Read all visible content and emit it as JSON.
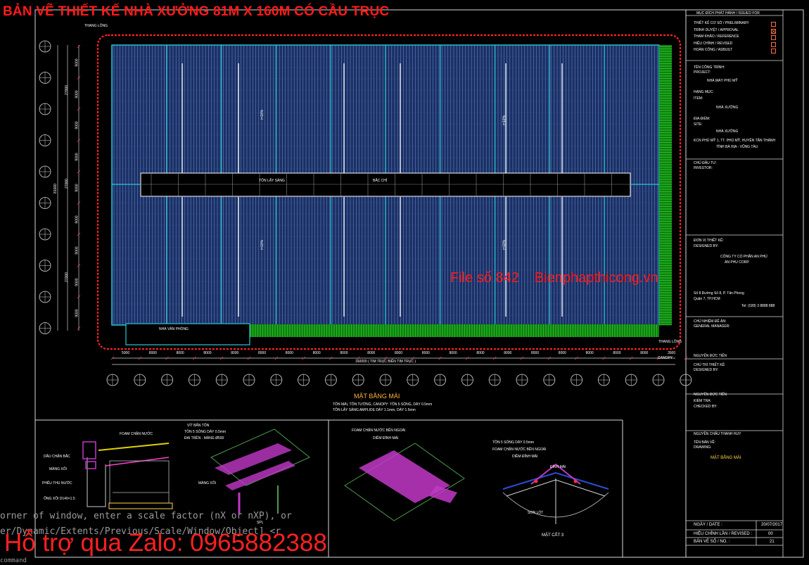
{
  "title": "BẢN VẼ THIẾT KẾ NHÀ XƯỞNG 81M X 160M CÓ CẦU TRỤC",
  "watermark": {
    "file": "File số 842",
    "site": "Bienphapthicong.vn"
  },
  "support": "Hỗ trợ qua Zalo: 0965882388",
  "command_lines": [
    "orner of window, enter a scale factor (nX or nXP), or",
    "er/Dynamic/Extents/Previous/Scale/Window/Object] <r",
    "command"
  ],
  "plan": {
    "labels": {
      "top_left": "THANG LÔNG",
      "skylight": "TÔN LẤY SÁNG",
      "ridge": "BẮC CHỈ",
      "office": "NHÀ VĂN PHÒNG",
      "canopy": "CANOPY",
      "bottom_right": "THANG LÔNG",
      "dim_total": "160000 ( TIM TRỤC BIÊN TIM TRỤC )",
      "slope_a": "i=10%",
      "slope_b": "i=10%",
      "slope_c": "i=10%",
      "slope_d": "i=10%",
      "left_total": "81000",
      "left_dims": [
        "9000",
        "9000",
        "9000",
        "9000",
        "9000",
        "9000",
        "9000",
        "9000",
        "9000"
      ],
      "left_sub": [
        "27000",
        "27000",
        "27000"
      ],
      "bottom_dims": [
        "5000",
        "8000",
        "8000",
        "8000",
        "8000",
        "8000",
        "8000",
        "8000",
        "8000",
        "8000",
        "8000",
        "8000",
        "8000",
        "8000",
        "8000",
        "8000",
        "8000",
        "8000",
        "8000",
        "8000",
        "3500"
      ]
    },
    "caption": "MẶT BẰNG MÁI",
    "notes": [
      "TÔN MÁI, TÔN TƯỜNG, CANOPY: TÔN 5 SÓNG, DÀY 0.5mm",
      "TÔN LẤY SÁNG AMPLIDE  DÀY 1.1mm, DÀY 1.5mm"
    ]
  },
  "details": {
    "left": [
      "FOAM CHẶN NƯỚC",
      "DẦU CHẶN BẮC",
      "MÁNG XỐI",
      "PHỄU THU NƯỚC",
      "ỐNG XỐI D140×1.5",
      "VÍT BẮN TÔN",
      "TÔN 5 SÓNG DÀY 0.5mm",
      "ĐAI TRÊN - MÁNG Ø500",
      "MÁNG XỐI",
      "SPL"
    ],
    "mid": [
      "FOAM CHẶN NƯỚC BÊN NGOÀI",
      "DIỀM ĐỈNH MÁI"
    ],
    "right": [
      "TÔN 5 SÓNG DÀY 0.5mm",
      "FOAM CHẶN NƯỚC BÊN NGOÀI",
      "DIỀM ĐỈNH MÁI",
      "ĐỈNH MÁI",
      "SƠN LÓT"
    ],
    "section_title": "MẶT CẮT 3"
  },
  "title_block": {
    "header": "MỤC ĐÍCH PHÁT HÀNH / ISSUED FOR",
    "issue_items": [
      {
        "label": "THIẾT KẾ CƠ SỞ / PRELIMINARY",
        "checked": false
      },
      {
        "label": "TRÌNH DUYỆT / APPROVAL",
        "checked": true
      },
      {
        "label": "THAM KHẢO / REFERENCE",
        "checked": false
      },
      {
        "label": "HIỆU CHỈNH / REVISED",
        "checked": false
      },
      {
        "label": "HOÀN CÔNG / ASBUILT",
        "checked": false
      }
    ],
    "project_label": "TÊN CÔNG TRÌNH:",
    "project_label_en": "PROJECT:",
    "project": "NHÀ MÁY PHÚ MỸ",
    "item_label": "HẠNG MỤC:",
    "item_label_en": "ITEM:",
    "item": "NHÀ XƯỞNG",
    "location_label": "ĐỊA ĐIỂM:",
    "location_label_en": "SITE:",
    "location_a": "NHÀ XƯỞNG",
    "location_b": "KCN PHÚ MỸ 1, TT. PHÚ MỸ, HUYỆN TÂN THÀNH",
    "location_c": "TỈNH BÀ RỊA - VŨNG TÀU",
    "owner_label": "CHỦ ĐẦU TƯ:",
    "owner_label_en": "INVESTOR:",
    "designer_label": "ĐƠN VỊ THIẾT KẾ:",
    "designer_label_en": "DESIGNED BY:",
    "designer_name": "CÔNG TY CỔ PHẦN AN PHÚ",
    "designer_name_b": "AN PHU CORP.",
    "address_a": "Số 8 Đường Số 8, P. Tân Phong",
    "address_b": "Quận 7, TP.HCM",
    "phone": "Tel: (028) 3 8888 888",
    "director_label": "CHỦ NHIỆM ĐỀ ÁN:",
    "director_label_en": "GENERAL MANAGER:",
    "director": "NGUYỄN ĐỨC TIẾN",
    "design_label": "CHỦ TRÌ THIẾT KẾ:",
    "design_label_en": "DESIGNED BY:",
    "design_name": "NGUYỄN ĐỨC TIẾN",
    "check_label": "KIỂM TRA:",
    "check_label_en": "CHECKED BY:",
    "draw_name": "NGUYỄN CHÂU THANH HUY",
    "drawing_label": "TÊN BẢN VẼ:",
    "drawing_label_en": "DRAWING:",
    "drawing_title": "MẶT BẰNG MÁI",
    "date_label": "NGÀY / DATE :",
    "date": "20/07/2017",
    "rev_label": "HIỆU CHỈNH LẦN / REVISED :",
    "rev": "00",
    "sheet_label": "BẢN VẼ SỐ / NO. :",
    "sheet": "21"
  },
  "colors": {
    "roof": "#1a2f63",
    "roof_line": "#6f8fd0",
    "cyan": "#27c9d8",
    "green": "#1fbf1f",
    "red": "#ff1a1a",
    "white": "#ffffff",
    "magenta": "#c238c8"
  }
}
